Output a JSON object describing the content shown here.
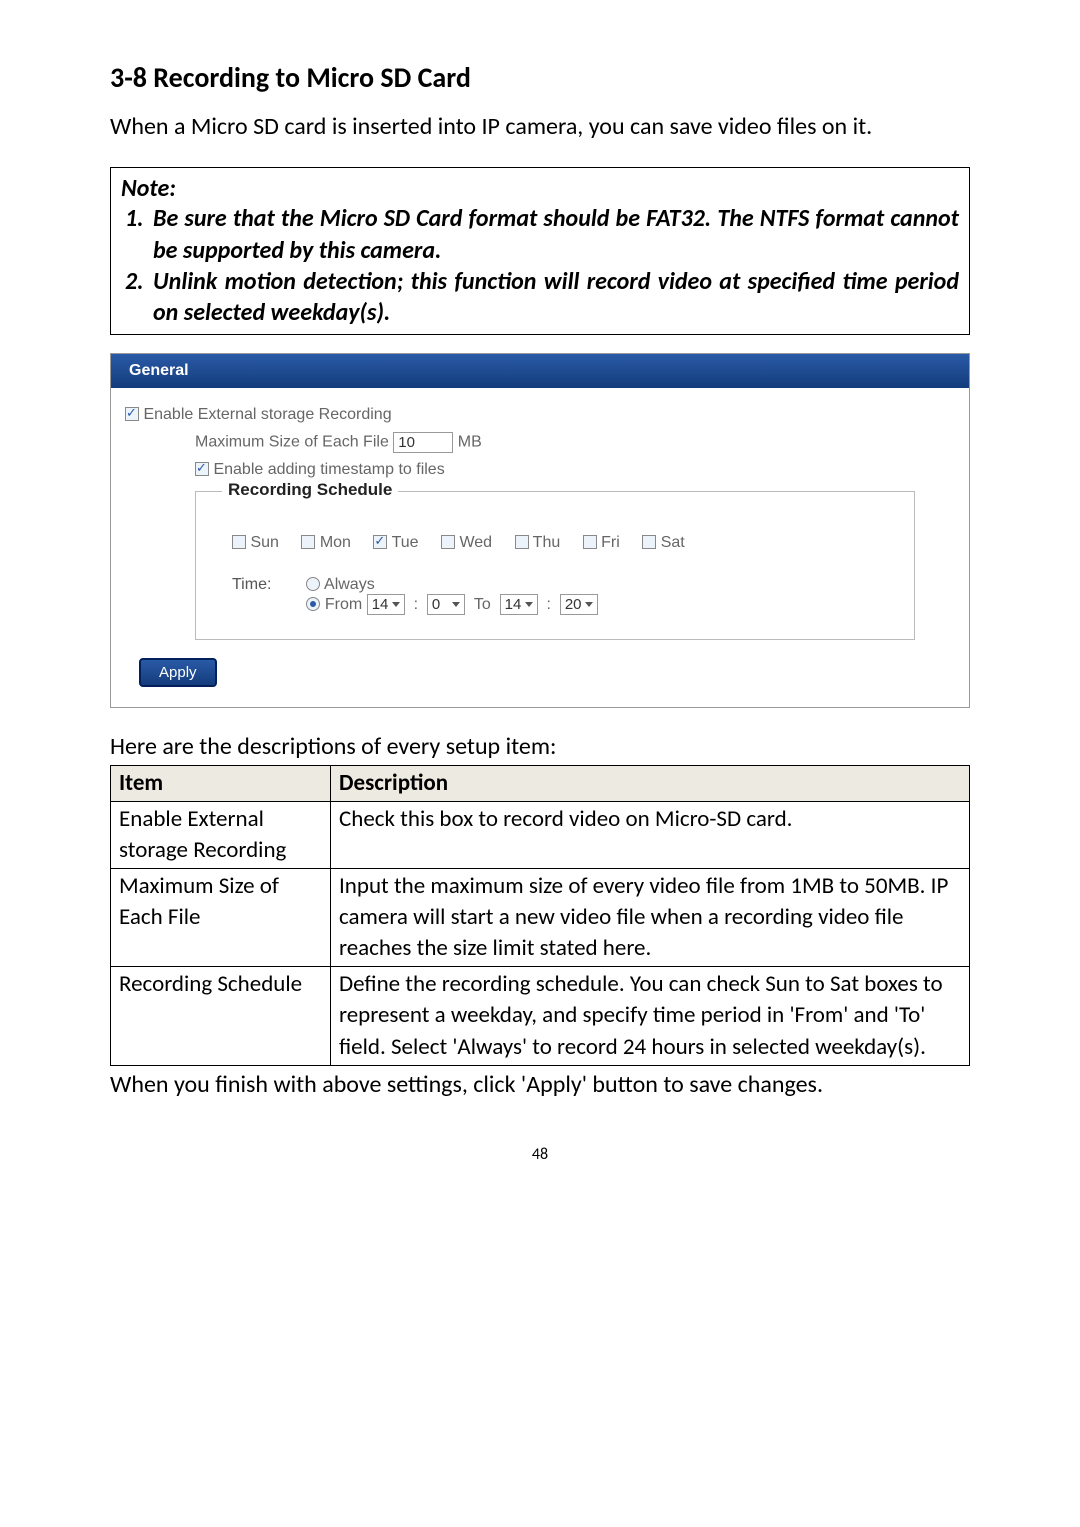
{
  "section_title": "3-8 Recording to Micro SD Card",
  "intro": "When a Micro SD card is inserted into IP camera, you can save video files on it.",
  "note": {
    "label": "Note:",
    "items": [
      "Be sure that the Micro SD Card format should be FAT32.   The NTFS format cannot be supported by this camera.",
      "Unlink motion detection; this function will record video at specified time period on selected weekday(s)."
    ]
  },
  "panel": {
    "tab": "General",
    "enable_recording_label": "Enable External storage Recording",
    "max_size_label": "Maximum Size of Each File",
    "max_size_value": "10",
    "max_size_unit": "MB",
    "enable_timestamp_label": "Enable adding timestamp to files",
    "schedule_legend": "Recording Schedule",
    "days": {
      "sun": "Sun",
      "mon": "Mon",
      "tue": "Tue",
      "wed": "Wed",
      "thu": "Thu",
      "fri": "Fri",
      "sat": "Sat"
    },
    "time_label": "Time:",
    "always_label": "Always",
    "from_label": "From",
    "to_label": "To",
    "from_h": "14",
    "from_m": "0",
    "to_h": "14",
    "to_m": "20",
    "apply_label": "Apply"
  },
  "table_intro": "Here are the descriptions of every setup item:",
  "table": {
    "headers": {
      "item": "Item",
      "desc": "Description"
    },
    "rows": [
      {
        "item": "Enable External storage Recording",
        "desc": "Check this box to record video on Micro-SD card."
      },
      {
        "item": "Maximum Size of Each File",
        "desc": "Input the maximum size of every video file from 1MB to 50MB. IP camera will start a new video file when a recording video file reaches the size limit stated here."
      },
      {
        "item": "Recording Schedule",
        "desc": "Define the recording schedule. You can check Sun to Sat boxes to represent a weekday, and specify time period in 'From' and 'To' field. Select 'Always' to record 24 hours in selected weekday(s)."
      }
    ]
  },
  "footnote": "When you finish with above settings, click 'Apply' button to save changes.",
  "page_number": "48"
}
